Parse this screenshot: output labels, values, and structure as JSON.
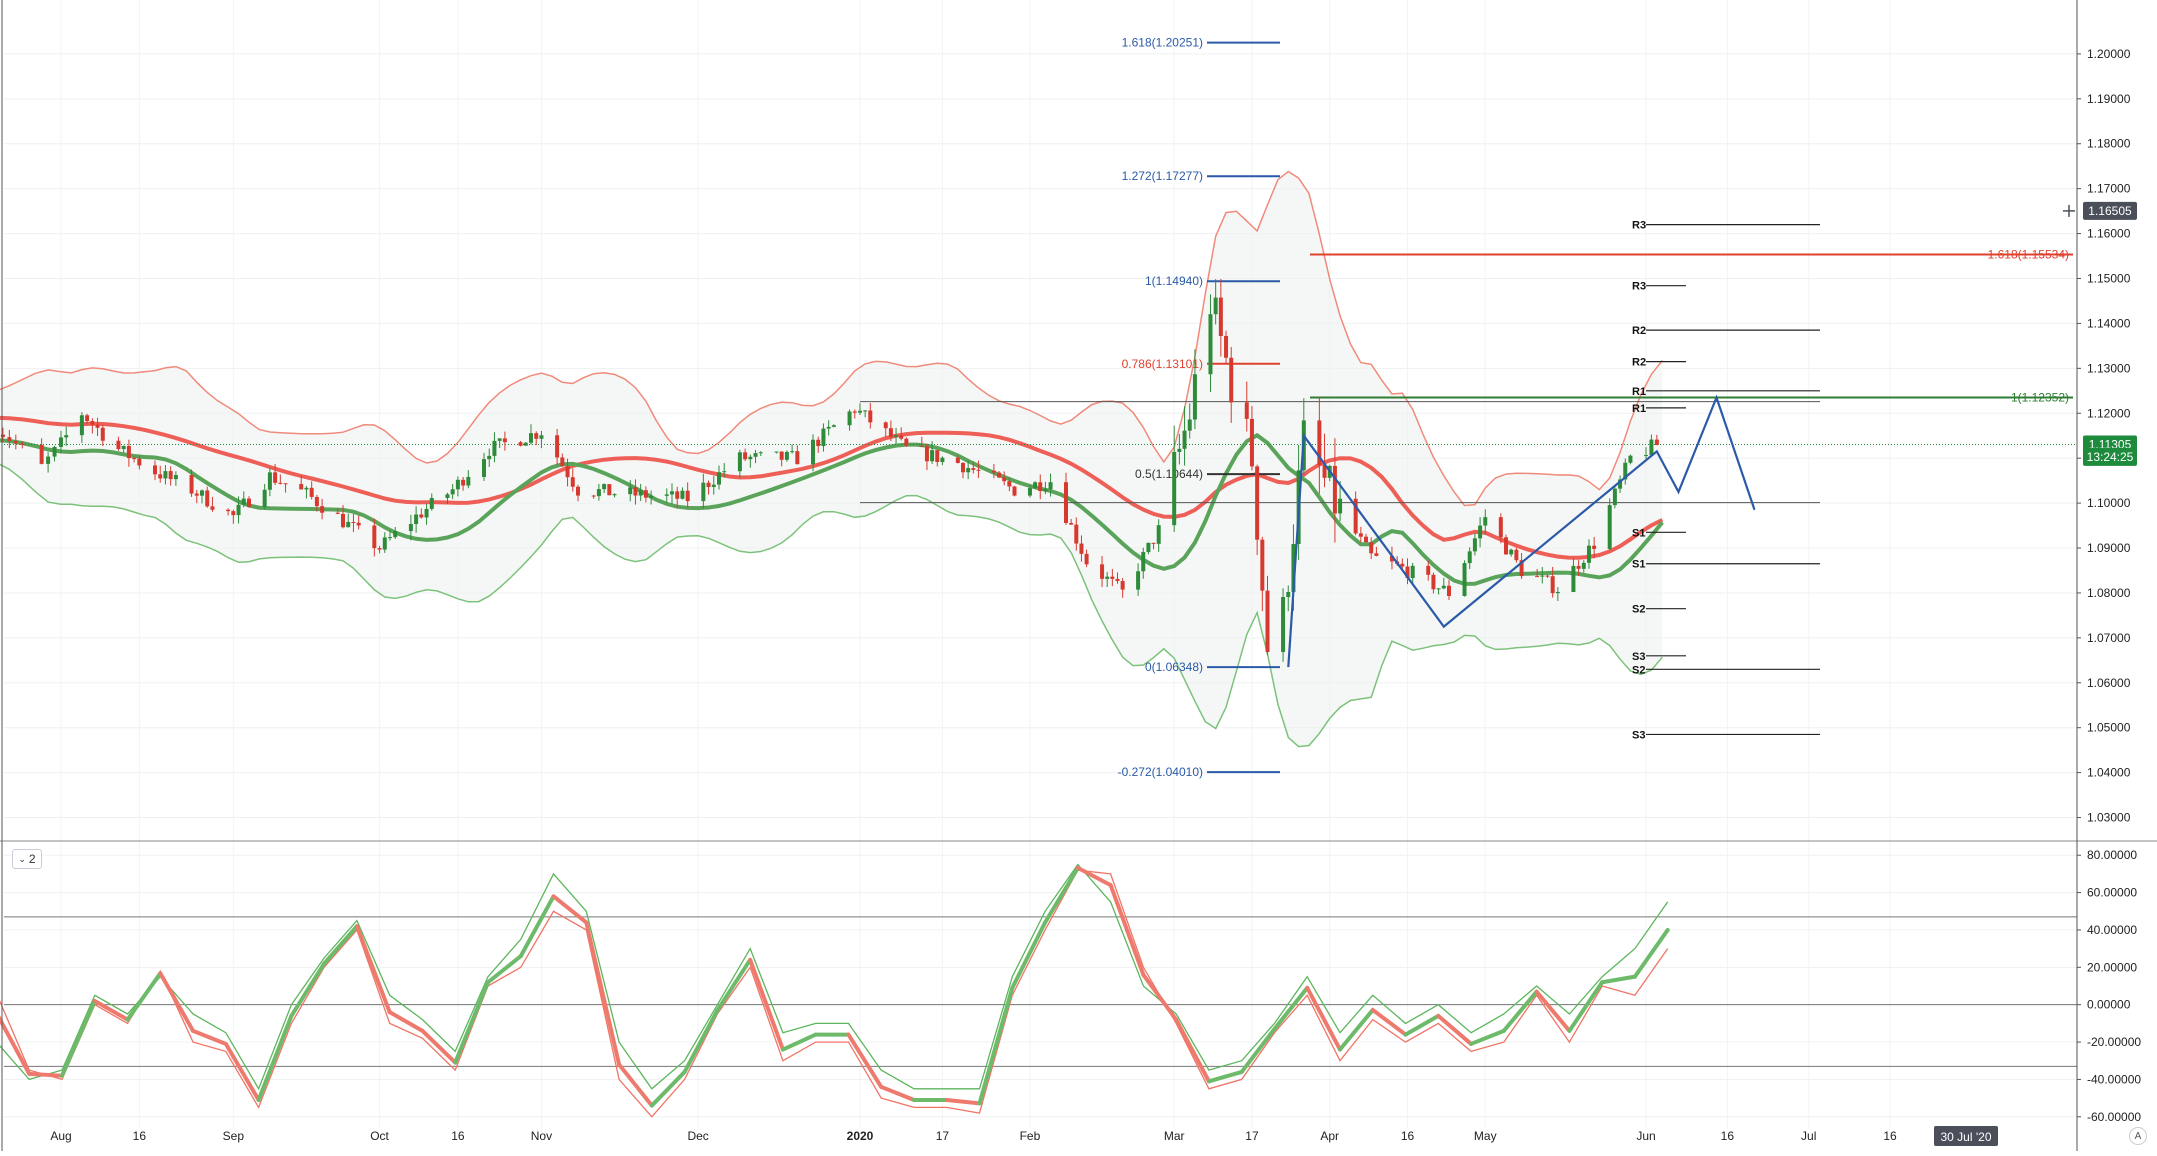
{
  "chart_data": [
    {
      "type": "candlestick",
      "title": "",
      "xlabel": "",
      "ylabel": "",
      "ylim": [
        1.025,
        1.212
      ],
      "y_ticks": [
        "1.03000",
        "1.04000",
        "1.05000",
        "1.06000",
        "1.07000",
        "1.08000",
        "1.09000",
        "1.10000",
        "1.11000",
        "1.12000",
        "1.13000",
        "1.14000",
        "1.15000",
        "1.16000",
        "1.17000",
        "1.18000",
        "1.19000",
        "1.20000"
      ],
      "x_ticks": [
        "Aug",
        "16",
        "Sep",
        "Oct",
        "16",
        "Nov",
        "Dec",
        "2020",
        "17",
        "Feb",
        "Mar",
        "17",
        "Apr",
        "16",
        "May",
        "Jun",
        "16",
        "Jul",
        "16"
      ],
      "price_path": [
        {
          "date": "2019-07-22",
          "close": 1.117
        },
        {
          "date": "2019-07-29",
          "close": 1.108
        },
        {
          "date": "2019-08-05",
          "close": 1.12
        },
        {
          "date": "2019-08-12",
          "close": 1.112
        },
        {
          "date": "2019-08-19",
          "close": 1.107
        },
        {
          "date": "2019-08-26",
          "close": 1.103
        },
        {
          "date": "2019-09-03",
          "close": 1.097
        },
        {
          "date": "2019-09-10",
          "close": 1.106
        },
        {
          "date": "2019-09-17",
          "close": 1.102
        },
        {
          "date": "2019-09-24",
          "close": 1.096
        },
        {
          "date": "2019-10-01",
          "close": 1.09
        },
        {
          "date": "2019-10-08",
          "close": 1.097
        },
        {
          "date": "2019-10-15",
          "close": 1.103
        },
        {
          "date": "2019-10-22",
          "close": 1.112
        },
        {
          "date": "2019-11-01",
          "close": 1.116
        },
        {
          "date": "2019-11-08",
          "close": 1.103
        },
        {
          "date": "2019-11-18",
          "close": 1.102
        },
        {
          "date": "2019-11-29",
          "close": 1.101
        },
        {
          "date": "2019-12-09",
          "close": 1.11
        },
        {
          "date": "2019-12-20",
          "close": 1.11
        },
        {
          "date": "2019-12-31",
          "close": 1.121
        },
        {
          "date": "2020-01-10",
          "close": 1.112
        },
        {
          "date": "2020-01-20",
          "close": 1.109
        },
        {
          "date": "2020-01-31",
          "close": 1.103
        },
        {
          "date": "2020-02-07",
          "close": 1.105
        },
        {
          "date": "2020-02-14",
          "close": 1.087
        },
        {
          "date": "2020-02-21",
          "close": 1.08
        },
        {
          "date": "2020-02-28",
          "close": 1.094
        },
        {
          "date": "2020-03-05",
          "close": 1.12
        },
        {
          "date": "2020-03-09",
          "close": 1.145
        },
        {
          "date": "2020-03-13",
          "close": 1.127
        },
        {
          "date": "2020-03-17",
          "close": 1.11
        },
        {
          "date": "2020-03-20",
          "close": 1.068
        },
        {
          "date": "2020-03-23",
          "close": 1.075
        },
        {
          "date": "2020-03-27",
          "close": 1.114
        },
        {
          "date": "2020-04-02",
          "close": 1.1
        },
        {
          "date": "2020-04-09",
          "close": 1.088
        },
        {
          "date": "2020-04-16",
          "close": 1.085
        },
        {
          "date": "2020-04-24",
          "close": 1.08
        },
        {
          "date": "2020-05-01",
          "close": 1.097
        },
        {
          "date": "2020-05-08",
          "close": 1.085
        },
        {
          "date": "2020-05-15",
          "close": 1.081
        },
        {
          "date": "2020-05-22",
          "close": 1.091
        },
        {
          "date": "2020-05-29",
          "close": 1.11
        },
        {
          "date": "2020-06-03",
          "close": 1.113
        }
      ],
      "fib_levels": [
        {
          "label": "1.618(1.20251)",
          "price": 1.20251,
          "color": "#2a5aa8"
        },
        {
          "label": "1.272(1.17277)",
          "price": 1.17277,
          "color": "#2a5aa8"
        },
        {
          "label": "1(1.14940)",
          "price": 1.1494,
          "color": "#2a5aa8"
        },
        {
          "label": "0.786(1.13101)",
          "price": 1.13101,
          "color": "#e0412f"
        },
        {
          "label": "0.5(1.10644)",
          "price": 1.10644,
          "color": "#333333"
        },
        {
          "label": "0(1.06348)",
          "price": 1.06348,
          "color": "#2a5aa8"
        },
        {
          "label": "-0.272(1.04010)",
          "price": 1.0401,
          "color": "#2a5aa8"
        }
      ],
      "pivot_levels_long": [
        {
          "label": "R3",
          "price": 1.162
        },
        {
          "label": "R2",
          "price": 1.1385
        },
        {
          "label": "R1",
          "price": 1.125
        },
        {
          "label": "S1",
          "price": 1.0865
        },
        {
          "label": "S2",
          "price": 1.063
        },
        {
          "label": "S3",
          "price": 1.0485
        }
      ],
      "pivot_levels_short": [
        {
          "label": "R3",
          "price": 1.1484
        },
        {
          "label": "R2",
          "price": 1.1315
        },
        {
          "label": "R1",
          "price": 1.1212
        },
        {
          "label": "S1",
          "price": 1.0935
        },
        {
          "label": "S2",
          "price": 1.0765
        },
        {
          "label": "S3",
          "price": 1.066
        }
      ],
      "extension_lines": [
        {
          "label": "1.618(1.15534)",
          "price": 1.15534,
          "color": "#e0412f"
        },
        {
          "label": "1(1.12352)",
          "price": 1.12352,
          "color": "#2f7d32"
        }
      ],
      "price_badges": [
        {
          "text": "1.16505",
          "price": 1.16505,
          "color": "#4a4f5a"
        },
        {
          "text": "1.11305",
          "price": 1.11305,
          "color": "#1e8a3c"
        },
        {
          "text": "13:24:25",
          "price": 1.1103,
          "color": "#1e8a3c"
        }
      ],
      "projection_pattern": [
        {
          "date": "2020-03-24",
          "price": 1.0635
        },
        {
          "date": "2020-03-27",
          "price": 1.115
        },
        {
          "date": "2020-04-23",
          "price": 1.0725
        },
        {
          "date": "2020-06-03",
          "price": 1.1115
        },
        {
          "date": "2020-06-07",
          "price": 1.1025
        },
        {
          "date": "2020-06-14",
          "price": 1.1235
        },
        {
          "date": "2020-06-21",
          "price": 1.0985
        }
      ],
      "bands": [
        {
          "name": "upper-red",
          "color": "#f08a7a"
        },
        {
          "name": "middle-red",
          "color": "#ee5f58"
        },
        {
          "name": "middle-green",
          "color": "#5aa35a"
        },
        {
          "name": "lower-green",
          "color": "#7cc27a"
        }
      ],
      "date_badge": "30 Jul '20"
    },
    {
      "type": "line",
      "title": "",
      "xlabel": "",
      "ylabel": "",
      "ylim": [
        -66,
        86
      ],
      "y_ticks": [
        "80.00000",
        "60.00000",
        "40.00000",
        "20.00000",
        "0.00000",
        "-20.00000",
        "-40.00000",
        "-60.00000"
      ],
      "reference_lines": [
        47,
        0,
        -33
      ],
      "series": [
        {
          "name": "",
          "color": "#f07466",
          "values": [
            6,
            -35,
            -40,
            0,
            -10,
            18,
            -20,
            -25,
            -55,
            -10,
            20,
            40,
            -10,
            -18,
            -35,
            10,
            20,
            50,
            40,
            -40,
            -60,
            -40,
            -5,
            20,
            -30,
            -20,
            -20,
            -50,
            -55,
            -55,
            -58,
            5,
            40,
            72,
            70,
            20,
            -10,
            -45,
            -40,
            -15,
            5,
            -30,
            -8,
            -20,
            -10,
            -25,
            -20,
            5,
            -20,
            10,
            5,
            30
          ]
        },
        {
          "name": "",
          "color": "#5cb65c",
          "values": [
            -20,
            -40,
            -35,
            5,
            -5,
            15,
            -5,
            -15,
            -45,
            0,
            25,
            45,
            5,
            -8,
            -25,
            15,
            35,
            70,
            50,
            -20,
            -45,
            -30,
            0,
            30,
            -15,
            -10,
            -10,
            -35,
            -45,
            -45,
            -45,
            15,
            50,
            75,
            55,
            10,
            -5,
            -35,
            -30,
            -10,
            15,
            -15,
            5,
            -10,
            0,
            -15,
            -5,
            10,
            -5,
            15,
            30,
            55
          ]
        }
      ]
    }
  ],
  "indicator_button": {
    "label": "2"
  },
  "auto_button": {
    "label": "A"
  }
}
